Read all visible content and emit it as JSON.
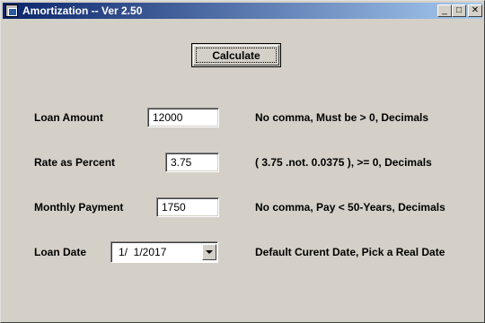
{
  "window": {
    "title": "Amortization -- Ver 2.50",
    "minimize_glyph": "_",
    "maximize_glyph": "□",
    "close_glyph": "✕"
  },
  "toolbar": {
    "calculate_label": "Calculate"
  },
  "form": {
    "loan_amount": {
      "label": "Loan Amount",
      "value": "12000",
      "hint": "No comma,  Must be > 0,  Decimals"
    },
    "rate": {
      "label": "Rate as Percent",
      "value": "3.75",
      "hint": "( 3.75 .not. 0.0375 ),  >= 0,  Decimals"
    },
    "payment": {
      "label": "Monthly Payment",
      "value": "1750",
      "hint": "No comma,  Pay < 50-Years,  Decimals"
    },
    "loan_date": {
      "label": "Loan Date",
      "value": "1/  1/2017",
      "hint": "Default Curent Date,  Pick a Real Date"
    }
  },
  "colors": {
    "titlebar_start": "#0a246a",
    "titlebar_end": "#a6caf0",
    "window_bg": "#d4d0c8"
  }
}
